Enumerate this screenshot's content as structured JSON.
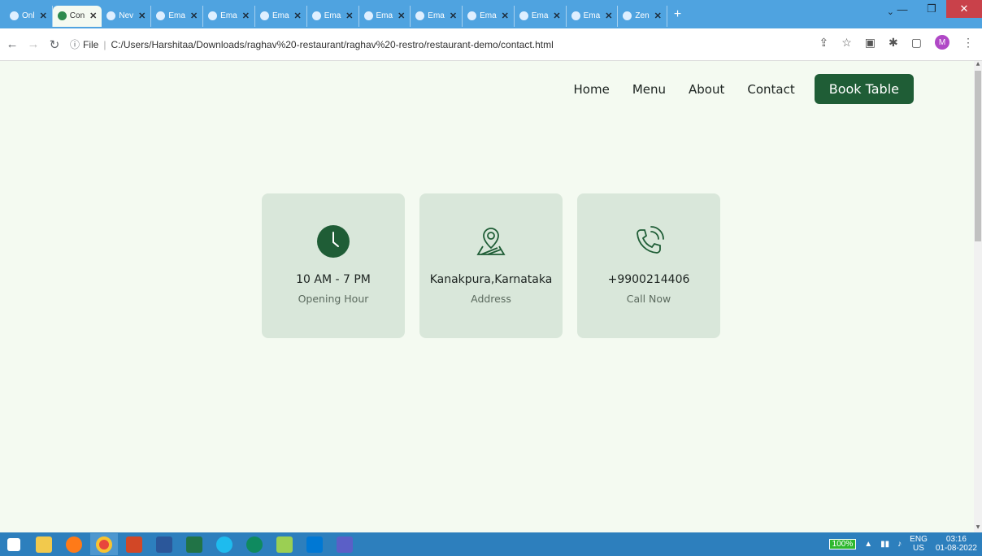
{
  "browser": {
    "tabs": [
      {
        "label": "Onl",
        "active": false
      },
      {
        "label": "Con",
        "active": true
      },
      {
        "label": "Nev",
        "active": false
      },
      {
        "label": "Ema",
        "active": false
      },
      {
        "label": "Ema",
        "active": false
      },
      {
        "label": "Ema",
        "active": false
      },
      {
        "label": "Ema",
        "active": false
      },
      {
        "label": "Ema",
        "active": false
      },
      {
        "label": "Ema",
        "active": false
      },
      {
        "label": "Ema",
        "active": false
      },
      {
        "label": "Ema",
        "active": false
      },
      {
        "label": "Ema",
        "active": false
      },
      {
        "label": "Zen",
        "active": false
      }
    ],
    "new_tab": "+",
    "tab_close": "✕",
    "url_prefix": "File",
    "url": "C:/Users/Harshitaa/Downloads/raghav%20-restaurant/raghav%20-restro/restaurant-demo/contact.html",
    "profile_initial": "M"
  },
  "site": {
    "nav": {
      "home": "Home",
      "menu": "Menu",
      "about": "About",
      "contact": "Contact",
      "book": "Book Table"
    },
    "cards": [
      {
        "title": "10 AM - 7 PM",
        "subtitle": "Opening Hour",
        "icon": "clock-icon"
      },
      {
        "title": "Kanakpura,Karnataka",
        "subtitle": "Address",
        "icon": "location-pin-icon"
      },
      {
        "title": "+9900214406",
        "subtitle": "Call Now",
        "icon": "phone-icon"
      }
    ]
  },
  "taskbar": {
    "battery": "100%",
    "lang_top": "ENG",
    "lang_bottom": "US",
    "time": "03:16",
    "date": "01-08-2022"
  },
  "colors": {
    "accent": "#1f5d36",
    "page_bg": "#f4faf1",
    "card_bg": "#d9e7da",
    "tabbar": "#4fa3e0",
    "taskbar": "#2d7fbd"
  }
}
